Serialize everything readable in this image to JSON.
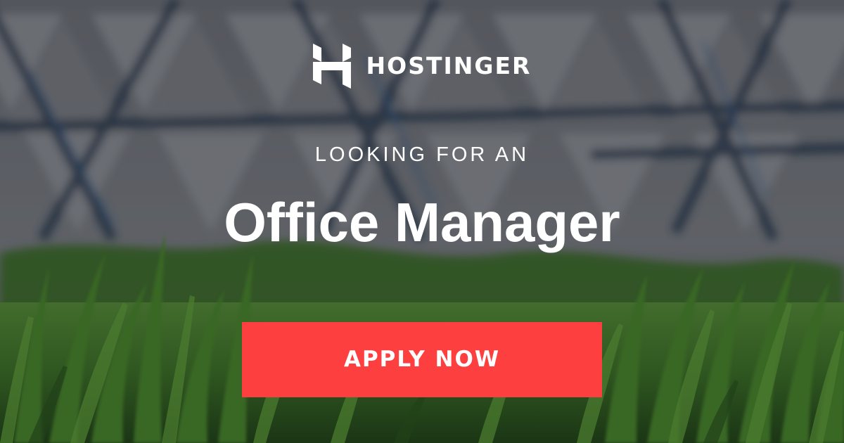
{
  "brand": {
    "name": "HOSTINGER",
    "logo_icon": "hostinger-h-logo-icon",
    "text_color": "#ffffff"
  },
  "banner": {
    "eyebrow": "LOOKING FOR AN",
    "title": "Office Manager"
  },
  "cta": {
    "label": "APPLY NOW",
    "color": "#fd3f3f"
  }
}
